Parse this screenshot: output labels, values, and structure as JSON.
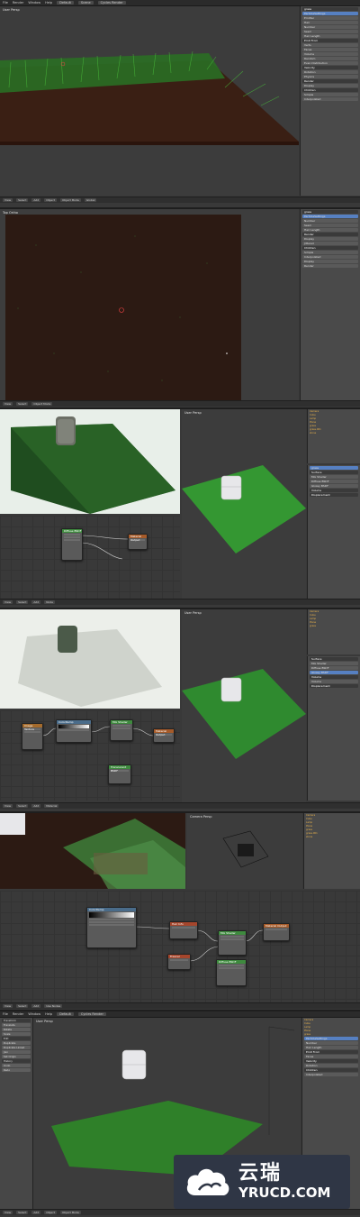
{
  "app": {
    "menu": [
      "File",
      "Render",
      "Window",
      "Help"
    ],
    "screen": "Default",
    "scene": "Scene",
    "engine": "Cycles Render"
  },
  "view": {
    "user_persp": "User Persp",
    "top_ortho": "Top Ortho",
    "camera_persp": "Camera Persp"
  },
  "mode": "Object Mode",
  "props": {
    "object_name": "grass",
    "particles_label": "ParticleSettings",
    "tabs": [
      "Emitter",
      "Hair"
    ],
    "rows": [
      "Number",
      "Seed",
      "Hair Length",
      "Emit From",
      "Verts",
      "Faces",
      "Volume",
      "Random",
      "Even Distribution",
      "Jittered",
      "Velocity",
      "Rotation",
      "Physics",
      "Render",
      "Display",
      "Children",
      "Simple",
      "Interpolated",
      "Display",
      "Render"
    ]
  },
  "outliner_items": [
    "Camera",
    "Cube",
    "Lamp",
    "Plane",
    "grass",
    "grass.001",
    "stone"
  ],
  "shader_rows": [
    "Surface",
    "Mix Shader",
    "Diffuse BSDF",
    "Glossy BSDF",
    "Volume",
    "Displacement"
  ],
  "nodes": {
    "n1": "Diffuse BSDF",
    "n2": "Material Output",
    "n3": "ColorRamp",
    "n4": "Mix Shader",
    "n5": "Image Texture",
    "n6": "Translucent BSDF",
    "n7": "Hair Info",
    "n8": "Fresnel"
  },
  "tool_shelf": [
    "Transform",
    "Translate",
    "Rotate",
    "Scale",
    "Edit",
    "Duplicate",
    "Duplicate Linked",
    "Join",
    "Set Origin",
    "History",
    "Undo",
    "Redo"
  ],
  "footer": [
    "View",
    "Select",
    "Add",
    "Object",
    "Object Mode",
    "Global"
  ],
  "node_footer": [
    "View",
    "Select",
    "Add",
    "Node",
    "Material",
    "Use Nodes"
  ],
  "watermark": {
    "cn": "云瑞",
    "en": "YRUCD.COM"
  },
  "colors": {
    "grass": "#2f8a2f",
    "soil": "#3a1f14",
    "accent": "#5680c2",
    "node_header": "#a65b2a"
  }
}
